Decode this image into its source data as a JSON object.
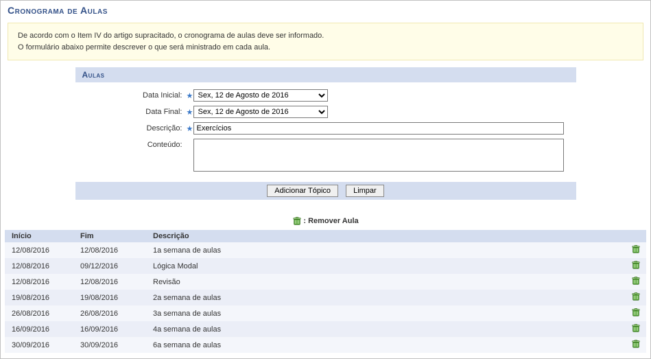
{
  "page_title": "Cronograma de Aulas",
  "info_box": {
    "line1": "De acordo com o Item IV do artigo supracitado, o cronograma de aulas deve ser informado.",
    "line2": "O formulário abaixo permite descrever o que será ministrado em cada aula."
  },
  "section_header": "Aulas",
  "form": {
    "data_inicial_label": "Data Inicial:",
    "data_inicial_value": "Sex, 12 de Agosto de 2016",
    "data_final_label": "Data Final:",
    "data_final_value": "Sex, 12 de Agosto de 2016",
    "descricao_label": "Descrição:",
    "descricao_value": "Exercícios",
    "conteudo_label": "Conteúdo:",
    "conteudo_value": ""
  },
  "buttons": {
    "add": "Adicionar Tópico",
    "clear": "Limpar"
  },
  "legend_text": ": Remover Aula",
  "table": {
    "headers": {
      "inicio": "Início",
      "fim": "Fim",
      "descricao": "Descrição"
    },
    "rows": [
      {
        "inicio": "12/08/2016",
        "fim": "12/08/2016",
        "descricao": "1a semana de aulas"
      },
      {
        "inicio": "12/08/2016",
        "fim": "09/12/2016",
        "descricao": "Lógica Modal"
      },
      {
        "inicio": "12/08/2016",
        "fim": "12/08/2016",
        "descricao": "Revisão"
      },
      {
        "inicio": "19/08/2016",
        "fim": "19/08/2016",
        "descricao": "2a semana de aulas"
      },
      {
        "inicio": "26/08/2016",
        "fim": "26/08/2016",
        "descricao": "3a semana de aulas"
      },
      {
        "inicio": "16/09/2016",
        "fim": "16/09/2016",
        "descricao": "4a semana de aulas"
      },
      {
        "inicio": "30/09/2016",
        "fim": "30/09/2016",
        "descricao": "6a semana de aulas"
      }
    ]
  }
}
